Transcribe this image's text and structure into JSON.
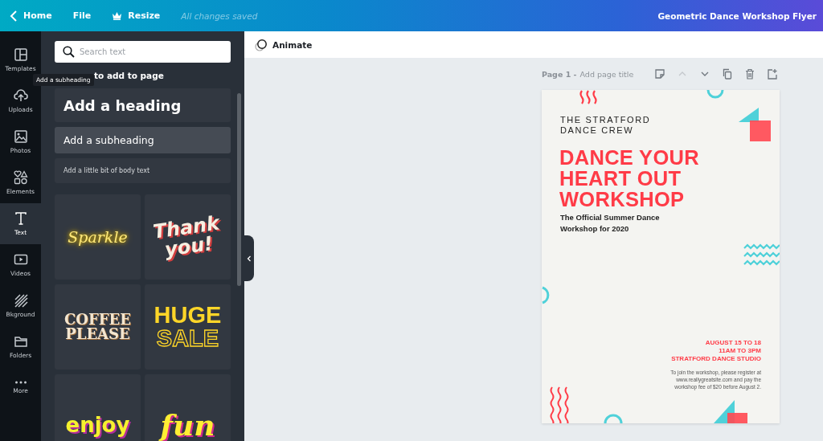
{
  "topbar": {
    "back": "Home",
    "menu": [
      {
        "label": "File",
        "kind": "plain"
      },
      {
        "label": "Resize",
        "kind": "crown"
      }
    ],
    "status": "All changes saved",
    "title": "Geometric Dance Workshop Flyer"
  },
  "rail": [
    {
      "label": "Templates",
      "kind": "templates",
      "selected": false
    },
    {
      "label": "Uploads",
      "kind": "uploads",
      "selected": false
    },
    {
      "label": "Photos",
      "kind": "photos",
      "selected": false
    },
    {
      "label": "Elements",
      "kind": "elements",
      "selected": false
    },
    {
      "label": "Text",
      "kind": "text",
      "selected": true
    },
    {
      "label": "Videos",
      "kind": "videos",
      "selected": false
    },
    {
      "label": "Bkground",
      "kind": "background",
      "selected": false
    },
    {
      "label": "Folders",
      "kind": "folders",
      "selected": false
    },
    {
      "label": "More",
      "kind": "more",
      "selected": false
    }
  ],
  "panel": {
    "search": {
      "placeholder": "Search text"
    },
    "title": "to add to page",
    "tooltip": "Add a subheading",
    "presets": [
      {
        "label": "Add a heading",
        "kind": "heading",
        "hovered": false
      },
      {
        "label": "Add a subheading",
        "kind": "subheading",
        "hovered": true
      },
      {
        "label": "Add a little bit of body text",
        "kind": "body",
        "hovered": false
      }
    ],
    "styles": [
      {
        "lines": [
          "Sparkle"
        ],
        "kind": "neon"
      },
      {
        "lines": [
          "Thank",
          "you!"
        ],
        "kind": "retro"
      },
      {
        "lines": [
          "COFFEE",
          "PLEASE"
        ],
        "kind": "slab"
      },
      {
        "lines": [
          "HUGE",
          "SALE"
        ],
        "kind": "outline"
      },
      {
        "lines": [
          "enjoy"
        ],
        "kind": "bubble"
      },
      {
        "lines": [
          "fun"
        ],
        "kind": "italic"
      }
    ]
  },
  "toolbar": {
    "animate": "Animate"
  },
  "page": {
    "number": "Page 1 -",
    "title_placeholder": "Add page title",
    "actions": [
      {
        "kind": "notes",
        "disabled": false
      },
      {
        "kind": "up",
        "disabled": true
      },
      {
        "kind": "down",
        "disabled": false
      },
      {
        "kind": "copy",
        "disabled": false
      },
      {
        "kind": "delete",
        "disabled": false
      },
      {
        "kind": "add",
        "disabled": false
      }
    ]
  },
  "flyer": {
    "crew": [
      "THE STRATFORD",
      "DANCE CREW"
    ],
    "headline": [
      "DANCE YOUR",
      "HEART OUT",
      "WORKSHOP"
    ],
    "subtitle": [
      "The Official Summer Dance",
      "Workshop for 2020"
    ],
    "event": [
      "AUGUST 15 TO 18",
      "11AM TO 3PM",
      "STRATFORD DANCE STUDIO"
    ],
    "details": [
      "To join the workshop, please register at",
      "www.reallygreatsite.com and pay the",
      "workshop fee of $20 before August 2."
    ]
  }
}
